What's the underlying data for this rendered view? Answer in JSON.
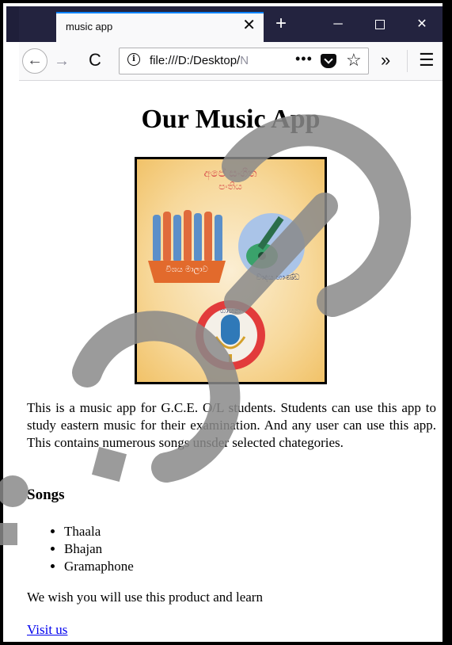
{
  "browser": {
    "tab_title": "music app",
    "tab_close": "✕",
    "new_tab": "+",
    "minimize": "─",
    "close": "✕",
    "back": "←",
    "forward": "→",
    "reload": "C",
    "url_info": "i",
    "url_main": "file:///D:/Desktop/",
    "url_fade": "N",
    "url_more": "•••",
    "url_star": "☆",
    "overflow": "»",
    "menu": "☰"
  },
  "page": {
    "heading": "Our Music App",
    "image_captions": {
      "top": [
        "අපේ සංගීත",
        "පංතිය"
      ],
      "instruments": "වාදය භාණ්ඩ",
      "singing": "ගායන",
      "keys": "විශය මාලාව"
    },
    "description": "This is a music app for G.C.E. O/L students. Students can use this app to study eastern music for their examination. And any user can use this app. This contains numerous songs unsder selected chategories.",
    "songs_heading": "Songs",
    "songs": [
      "Thaala",
      "Bhajan",
      "Gramaphone"
    ],
    "wish_text": "We wish you will use this product and learn",
    "link_text": "Visit us"
  },
  "colors": {
    "titlebar": "#23233f",
    "tab_accent": "#0a84ff",
    "link": "#0000ee",
    "watermark": "#8a8a8a"
  }
}
